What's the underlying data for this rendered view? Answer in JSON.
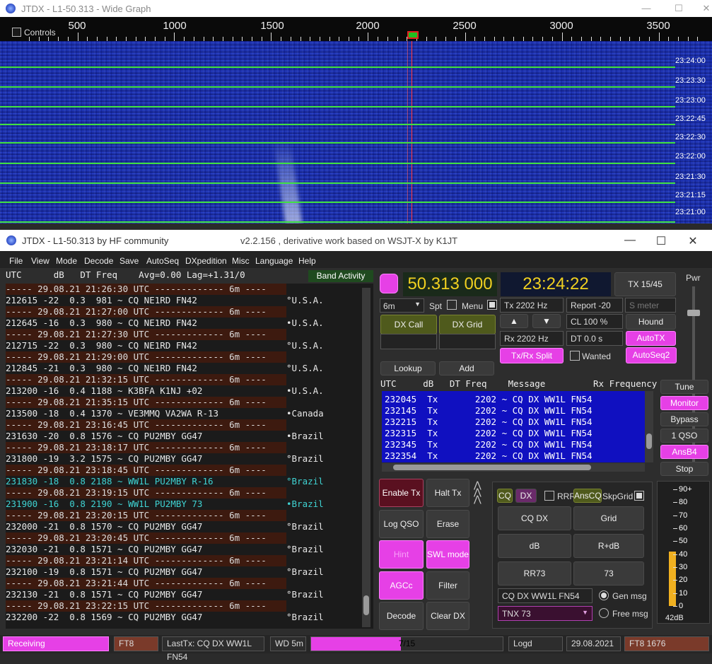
{
  "wide_graph": {
    "title": "JTDX - L1-50.313 - Wide Graph",
    "controls_label": "Controls",
    "freq_labels": [
      "500",
      "1000",
      "1500",
      "2000",
      "2500",
      "3000",
      "3500"
    ],
    "time_labels": [
      "23:24:00",
      "23:23:30",
      "23:23:00",
      "23:22:45",
      "23:22:30",
      "23:22:00",
      "23:21:30",
      "23:21:15",
      "23:21:00"
    ]
  },
  "main": {
    "title": "JTDX - L1-50.313   by HF community",
    "subtitle": "v2.2.156 , derivative work based on WSJT-X by K1JT",
    "menus": [
      "File",
      "View",
      "Mode",
      "Decode",
      "Save",
      "AutoSeq",
      "DXpedition",
      "Misc",
      "Language",
      "Help"
    ],
    "band_activity_header": "UTC      dB   DT Freq    Avg=0.00 Lag=+1.31/0",
    "band_activity_button": "Band Activity",
    "decodes": [
      {
        "type": "sep",
        "text": "----- 29.08.21 21:26:30 UTC ------------- 6m ----"
      },
      {
        "type": "cq",
        "text": "212615 -22  0.3  981 ~ CQ NE1RD FN42",
        "country": "°U.S.A."
      },
      {
        "type": "sep",
        "text": "----- 29.08.21 21:27:00 UTC ------------- 6m ----"
      },
      {
        "type": "cq",
        "text": "212645 -16  0.3  980 ~ CQ NE1RD FN42",
        "country": "•U.S.A."
      },
      {
        "type": "sep",
        "text": "----- 29.08.21 21:27:30 UTC ------------- 6m ----"
      },
      {
        "type": "cq",
        "text": "212715 -22  0.3  980 ~ CQ NE1RD FN42",
        "country": "°U.S.A."
      },
      {
        "type": "sep",
        "text": "----- 29.08.21 21:29:00 UTC ------------- 6m ----"
      },
      {
        "type": "cq",
        "text": "212845 -21  0.3  980 ~ CQ NE1RD FN42",
        "country": "°U.S.A."
      },
      {
        "type": "sep",
        "text": "----- 29.08.21 21:32:15 UTC ------------- 6m ----"
      },
      {
        "type": "cq",
        "text": "213200 -16  0.4 1188 ~ K3BFA K1NJ +02",
        "country": "•U.S.A."
      },
      {
        "type": "sep",
        "text": "----- 29.08.21 21:35:15 UTC ------------- 6m ----"
      },
      {
        "type": "cq",
        "text": "213500 -18  0.4 1370 ~ VE3MMQ VA2WA R-13",
        "country": "•Canada"
      },
      {
        "type": "sep",
        "text": "----- 29.08.21 23:16:45 UTC ------------- 6m ----"
      },
      {
        "type": "cq",
        "text": "231630 -20  0.8 1576 ~ CQ PU2MBY GG47",
        "country": "•Brazil"
      },
      {
        "type": "sep",
        "text": "----- 29.08.21 23:18:17 UTC ------------- 6m ----"
      },
      {
        "type": "cq",
        "text": "231800 -19  3.2 1575 ~ CQ PU2MBY GG47",
        "country": "°Brazil"
      },
      {
        "type": "sep",
        "text": "----- 29.08.21 23:18:45 UTC ------------- 6m ----"
      },
      {
        "type": "me",
        "text": "231830 -18  0.8 2188 ~ WW1L PU2MBY R-16",
        "country": "°Brazil"
      },
      {
        "type": "sep",
        "text": "----- 29.08.21 23:19:15 UTC ------------- 6m ----"
      },
      {
        "type": "me",
        "text": "231900 -16  0.8 2190 ~ WW1L PU2MBY 73",
        "country": "•Brazil"
      },
      {
        "type": "sep",
        "text": "----- 29.08.21 23:20:15 UTC ------------- 6m ----"
      },
      {
        "type": "cq",
        "text": "232000 -21  0.8 1570 ~ CQ PU2MBY GG47",
        "country": "°Brazil"
      },
      {
        "type": "sep",
        "text": "----- 29.08.21 23:20:45 UTC ------------- 6m ----"
      },
      {
        "type": "cq",
        "text": "232030 -21  0.8 1571 ~ CQ PU2MBY GG47",
        "country": "°Brazil"
      },
      {
        "type": "sep",
        "text": "----- 29.08.21 23:21:14 UTC ------------- 6m ----"
      },
      {
        "type": "cq",
        "text": "232100 -19  0.8 1571 ~ CQ PU2MBY GG47",
        "country": "°Brazil"
      },
      {
        "type": "sep",
        "text": "----- 29.08.21 23:21:44 UTC ------------- 6m ----"
      },
      {
        "type": "cq",
        "text": "232130 -21  0.8 1571 ~ CQ PU2MBY GG47",
        "country": "°Brazil"
      },
      {
        "type": "sep",
        "text": "----- 29.08.21 23:22:15 UTC ------------- 6m ----"
      },
      {
        "type": "cq",
        "text": "232200 -22  0.8 1569 ~ CQ PU2MBY GG47",
        "country": "°Brazil"
      }
    ],
    "frequency": "50.313 000",
    "time": "23:24:22",
    "tx_period": "TX 15/45",
    "s_meter_placeholder": "S meter",
    "band": "6m",
    "spt_label": "Spt",
    "menu_label": "Menu",
    "tx_freq": "Tx  2202  Hz",
    "rx_freq": "Rx  2202  Hz",
    "report": "Report -20",
    "cl": "CL  100 %",
    "dt": "DT 0.0 s",
    "buttons": {
      "dx_call": "DX Call",
      "dx_grid": "DX Grid",
      "hound": "Hound",
      "autotx": "AutoTX",
      "tx_rx_split": "Tx/Rx Split",
      "wanted": "Wanted",
      "autoseq2": "AutoSeq2",
      "lookup": "Lookup",
      "add": "Add",
      "tune": "Tune",
      "monitor": "Monitor",
      "bypass": "Bypass",
      "one_qso": "1 QSO",
      "ansb4": "AnsB4",
      "stop": "Stop",
      "enable_tx": "Enable Tx",
      "halt_tx": "Halt Tx",
      "log_qso": "Log QSO",
      "erase": "Erase",
      "hint": "Hint",
      "swl_mode": "SWL mode",
      "agcc": "AGCc",
      "filter": "Filter",
      "decode": "Decode",
      "clear_dx": "Clear DX"
    },
    "tx_list_header": "UTC     dB   DT Freq    Message         Rx Frequency",
    "tx_list": [
      "232045  Tx       2202 ~ CQ DX WW1L FN54",
      "232145  Tx       2202 ~ CQ DX WW1L FN54",
      "232215  Tx       2202 ~ CQ DX WW1L FN54",
      "232315  Tx       2202 ~ CQ DX WW1L FN54",
      "232345  Tx       2202 ~ CQ DX WW1L FN54",
      "232354  Tx       2202 ~ CQ DX WW1L FN54"
    ],
    "macros": {
      "cq": "CQ",
      "dx": "DX",
      "rrr": "RRR",
      "anscq": "AnsCQ",
      "skpgrid": "SkpGrid",
      "cq_dx": "CQ DX",
      "grid": "Grid",
      "db": "dB",
      "r_db": "R+dB",
      "rr73": "RR73",
      "m73": "73",
      "gen_msg_text": "CQ DX WW1L FN54",
      "gen_msg_label": "Gen msg",
      "free_msg_value": "TNX 73",
      "free_msg_label": "Free msg"
    },
    "pwr_label": "Pwr",
    "meter_labels": [
      "90+",
      "80",
      "70",
      "60",
      "50",
      "40",
      "30",
      "20",
      "10",
      "0"
    ],
    "meter_value_label": "42dB",
    "meter_level_db": 42
  },
  "status_bar": {
    "receiving": "Receiving",
    "mode": "FT8",
    "last_tx": "LastTx: CQ DX WW1L FN54",
    "wd": "WD 5m",
    "progress_text": "7/15",
    "progress_fraction": 0.47,
    "logd": "Logd",
    "date": "29.08.2021",
    "mode_count": "FT8  1676"
  },
  "colors": {
    "magenta": "#e640e6",
    "waterfall_blue": "#1c30a8",
    "freq_yellow": "#f0d020",
    "tx_list_blue": "#1010c0"
  }
}
